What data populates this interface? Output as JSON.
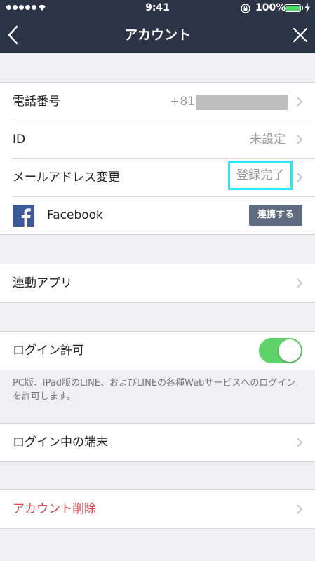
{
  "status_bar": {
    "time": "9:41",
    "battery_percent": "100%"
  },
  "nav": {
    "title": "アカウント"
  },
  "account": {
    "phone_label": "電話番号",
    "phone_value": "+81",
    "id_label": "ID",
    "id_value": "未設定",
    "email_label": "メールアドレス変更",
    "email_value": "登録完了",
    "facebook_label": "Facebook",
    "facebook_button": "連携する"
  },
  "linked_apps": {
    "label": "連動アプリ"
  },
  "login": {
    "allow_label": "ログイン許可",
    "allow_enabled": true,
    "note": "PC版、iPad版のLINE、およびLINEの各種Webサービスへのログインを許可します。"
  },
  "devices": {
    "label": "ログイン中の端末"
  },
  "delete": {
    "label": "アカウント削除"
  },
  "colors": {
    "header_bg": "#2b3347",
    "toggle_on": "#5fd36a",
    "danger": "#e0474b",
    "highlight": "#27e6ff",
    "facebook": "#3b5998"
  }
}
